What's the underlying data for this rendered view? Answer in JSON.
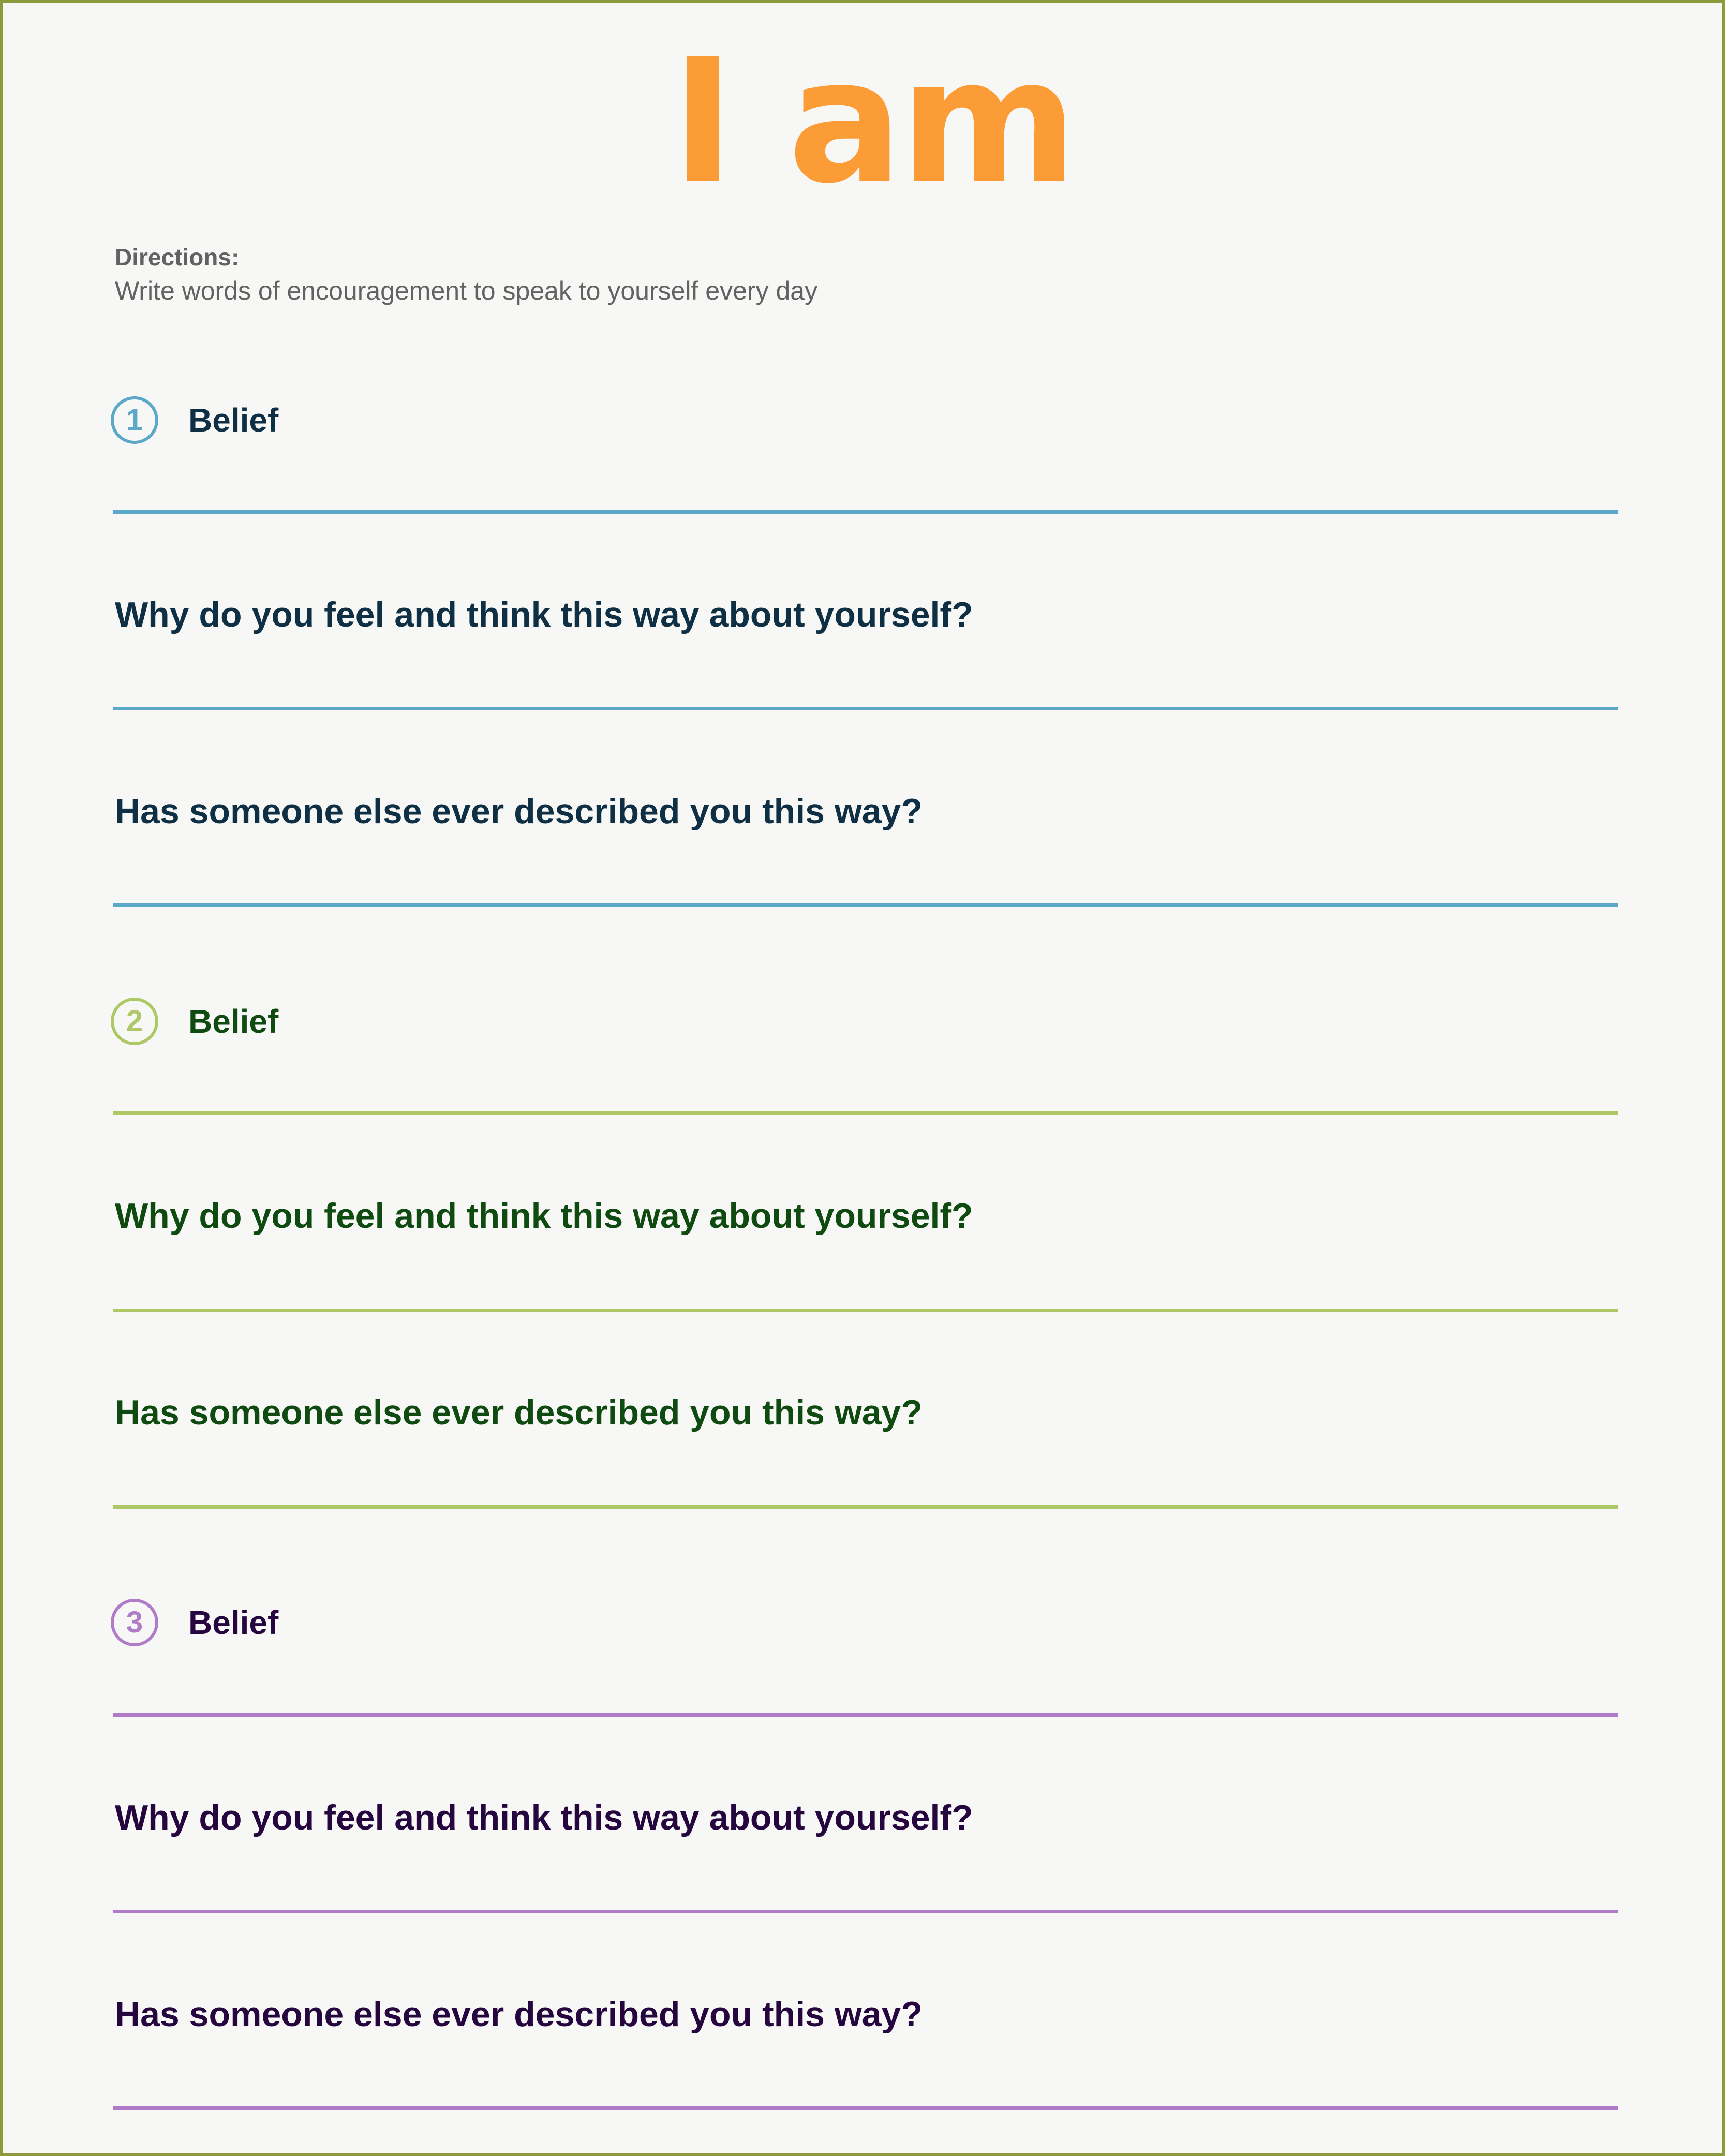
{
  "title": "I am",
  "directions": {
    "label": "Directions:",
    "text": "Write words of encouragement to speak to yourself every day"
  },
  "sections": [
    {
      "number": "1",
      "belief_label": "Belief",
      "question_1": "Why do you feel and think this way about yourself?",
      "question_2": "Has someone else ever described you this way?",
      "accent_color": "#5ba8c8",
      "text_color": "#0e2f44"
    },
    {
      "number": "2",
      "belief_label": "Belief",
      "question_1": "Why do you feel and think this way about yourself?",
      "question_2": "Has someone else ever described you this way?",
      "accent_color": "#aec865",
      "text_color": "#0f4a10"
    },
    {
      "number": "3",
      "belief_label": "Belief",
      "question_1": "Why do you feel and think this way about yourself?",
      "question_2": "Has someone else ever described you this way?",
      "accent_color": "#b07cc8",
      "text_color": "#25063f"
    }
  ],
  "colors": {
    "title": "#fc9c36",
    "frame_border": "#8c9a3c",
    "background": "#f7f7f5",
    "directions_text": "#626262"
  }
}
